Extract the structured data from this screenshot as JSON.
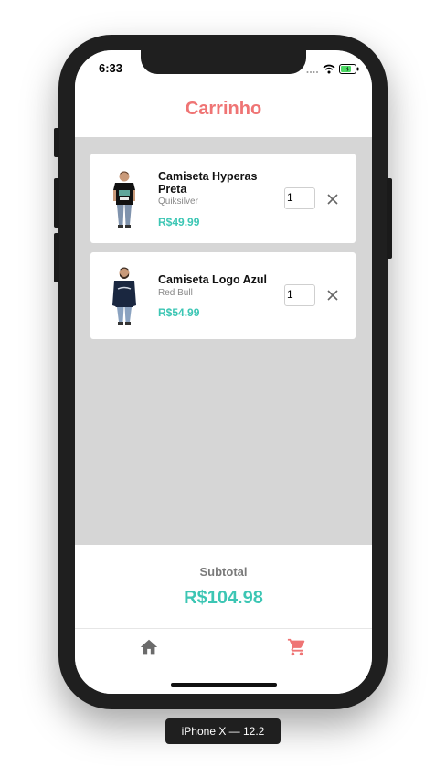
{
  "status_bar": {
    "time": "6:33"
  },
  "header": {
    "title": "Carrinho"
  },
  "cart": {
    "items": [
      {
        "name": "Camiseta Hyperas Preta",
        "brand": "Quiksilver",
        "price": "R$49.99",
        "quantity": "1"
      },
      {
        "name": "Camiseta Logo Azul",
        "brand": "Red Bull",
        "price": "R$54.99",
        "quantity": "1"
      }
    ]
  },
  "summary": {
    "label": "Subtotal",
    "value": "R$104.98"
  },
  "tabs": [
    {
      "icon": "home-icon",
      "active": false
    },
    {
      "icon": "cart-icon",
      "active": true
    }
  ],
  "colors": {
    "title": "#ef7474",
    "price": "#3cc6b4",
    "tab_active": "#ef7474",
    "tab_inactive": "#6b6b6b"
  },
  "device_label": "iPhone X — 12.2"
}
